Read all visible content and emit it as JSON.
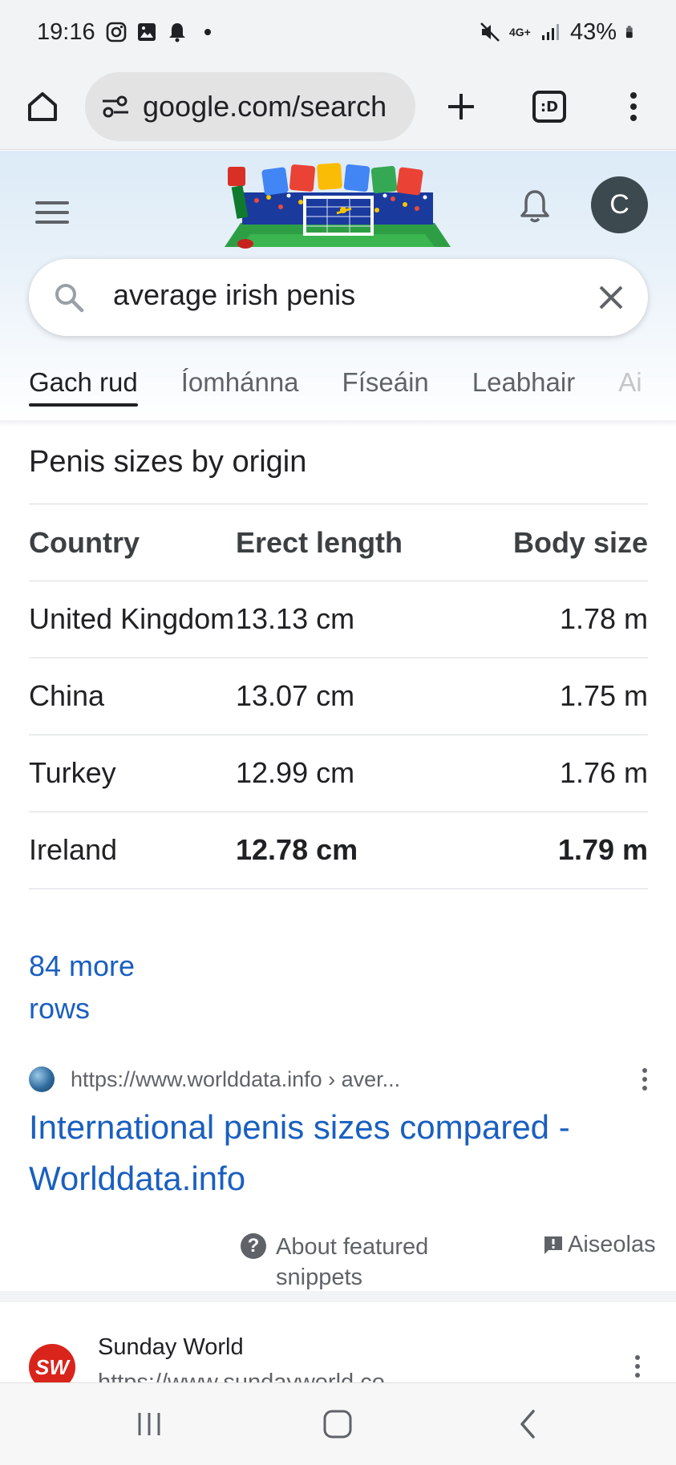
{
  "status_bar": {
    "time": "19:16",
    "network": "4G+",
    "battery": "43%"
  },
  "browser": {
    "url": "google.com/search"
  },
  "google": {
    "avatar_letter": "C",
    "query": "average irish penis"
  },
  "tabs": [
    {
      "label": "Gach rud",
      "active": true
    },
    {
      "label": "Íomhánna"
    },
    {
      "label": "Físeáin"
    },
    {
      "label": "Leabhair"
    },
    {
      "label": "Ai"
    }
  ],
  "snippet": {
    "title": "Penis sizes by origin",
    "headers": [
      "Country",
      "Erect length",
      "Body size"
    ],
    "rows": [
      {
        "country": "United Kingdom",
        "length": "13.13 cm",
        "body": "1.78 m"
      },
      {
        "country": "China",
        "length": "13.07 cm",
        "body": "1.75 m"
      },
      {
        "country": "Turkey",
        "length": "12.99 cm",
        "body": "1.76 m"
      },
      {
        "country": "Ireland",
        "length": "12.78 cm",
        "body": "1.79 m",
        "highlighted": true
      }
    ],
    "more_rows": "84 more rows",
    "source_url": "https://www.worlddata.info › aver...",
    "result_title": "International penis sizes compared - Worlddata.info",
    "about_label": "About featured snippets",
    "feedback_label": "Aiseolas"
  },
  "next_result": {
    "logo_text": "SW",
    "site_name": "Sunday World",
    "url": "https://www.sundayworld.co"
  },
  "colors": {
    "link": "#1a5fbf",
    "header_bg": "#dcebf7",
    "avatar_bg": "#3c4a4f",
    "sw_red": "#d9241c"
  }
}
